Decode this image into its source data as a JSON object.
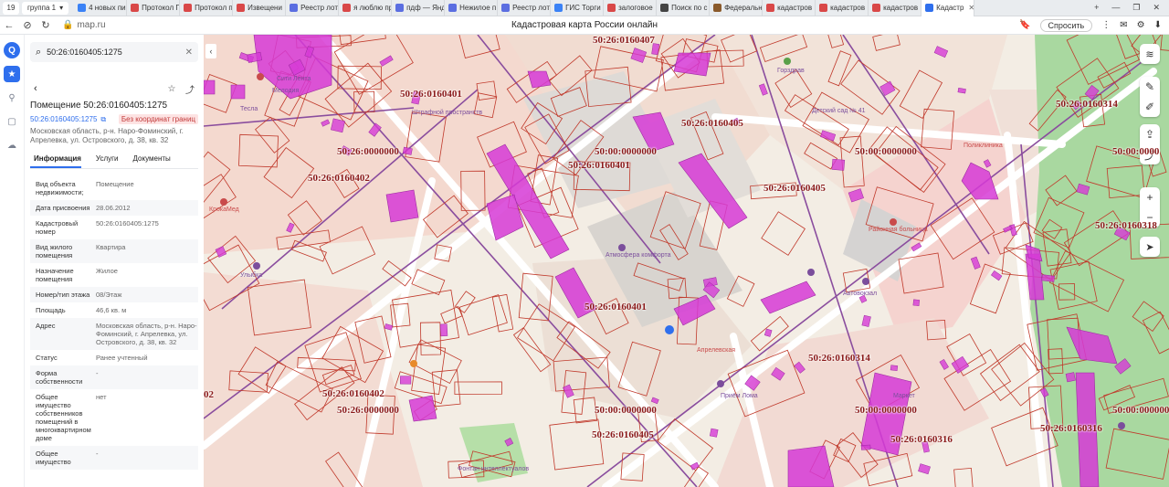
{
  "browser": {
    "tab_counter": "19",
    "tab_group": "группа 1",
    "tabs": [
      {
        "label": "4 новых пи",
        "color": "#3b82f6"
      },
      {
        "label": "Протокол П",
        "color": "#d94848"
      },
      {
        "label": "Протокол п",
        "color": "#d94848"
      },
      {
        "label": "Извещени",
        "color": "#d94848"
      },
      {
        "label": "Реестр лот",
        "color": "#5b6ee1"
      },
      {
        "label": "я люблю пр",
        "color": "#d94848"
      },
      {
        "label": "пдф — Янд",
        "color": "#5b6ee1"
      },
      {
        "label": "Нежилое п",
        "color": "#5b6ee1"
      },
      {
        "label": "Реестр лот",
        "color": "#5b6ee1"
      },
      {
        "label": "ГИС Торги",
        "color": "#3b82f6"
      },
      {
        "label": "залоговое",
        "color": "#d94848"
      },
      {
        "label": "Поиск по с",
        "color": "#444444"
      },
      {
        "label": "Федеральн",
        "color": "#8a5a2b"
      },
      {
        "label": "кадастров",
        "color": "#d94848"
      },
      {
        "label": "кадастров",
        "color": "#d94848"
      },
      {
        "label": "кадастров",
        "color": "#d94848"
      },
      {
        "label": "Кадастр",
        "color": "#2f6fed"
      }
    ],
    "url": "map.ru",
    "page_title": "Кадастровая карта России онлайн",
    "ask_label": "Спросить"
  },
  "panel": {
    "search_value": "50:26:0160405:1275",
    "title": "Помещение 50:26:0160405:1275",
    "number_link": "50:26:0160405:1275",
    "badge": "Без координат границ",
    "address_line": "Московская область, р-н. Наро-Фоминский, г. Апрелевка, ул. Островского, д. 38, кв. 32",
    "tabs": [
      "Информация",
      "Услуги",
      "Документы"
    ],
    "properties": [
      {
        "k": "Вид объекта недвижимости;",
        "v": "Помещение"
      },
      {
        "k": "Дата присвоения",
        "v": "28.06.2012"
      },
      {
        "k": "Кадастровый номер",
        "v": "50:26:0160405:1275"
      },
      {
        "k": "Вид жилого помещения",
        "v": "Квартира"
      },
      {
        "k": "Назначение помещения",
        "v": "Жилое"
      },
      {
        "k": "Номер/тип этажа",
        "v": "08/Этаж"
      },
      {
        "k": "Площадь",
        "v": "46,6 кв. м"
      },
      {
        "k": "Адрес",
        "v": "Московская область, р-н. Наро-Фоминский, г. Апрелевка, ул. Островского, д. 38, кв. 32"
      },
      {
        "k": "Статус",
        "v": "Ранее учтенный"
      },
      {
        "k": "Форма собственности",
        "v": "-"
      },
      {
        "k": "Общее имущество собственников помещений в многоквартирном доме",
        "v": "нет"
      },
      {
        "k": "Общее имущество",
        "v": "-"
      }
    ]
  },
  "map": {
    "cadastral_labels": [
      "50:26:0160407",
      "50:26:0160401",
      "50:26:0160405",
      "50:26:0160314",
      "50:26:0000000",
      "50:00:0000000",
      "50:00:0000000",
      "50:00:0000",
      "50:26:0160402",
      "50:26:0160401",
      "50:26:0160405",
      "50:26:0160318",
      "50:26:0160401",
      "50:26:0160314",
      "50:26:0160402",
      "50:26:0000000",
      "50:00:0000000",
      "50:00:0000000",
      "50:26:0160405",
      "50:26:0160316",
      "50:26:0160316",
      "50:00:0000000",
      "02"
    ],
    "poi": [
      "Сити Лента",
      "Мелодия",
      "Тесла",
      "Штрафной пространств",
      "Горздрав",
      "Детский сад № 41",
      "Поликлиника",
      "КрокаМед",
      "Атмосфера комфорта",
      "Районная больница",
      "Автовокзал",
      "Апрелевская",
      "Приём Лома",
      "Маркет",
      "Улыбка",
      "Фонтан интеллектуалов"
    ],
    "colors": {
      "parcel_stroke": "#c0392b",
      "highlight": "#d63ad6",
      "road": "#ffffff",
      "park": "#8fce8a"
    }
  }
}
